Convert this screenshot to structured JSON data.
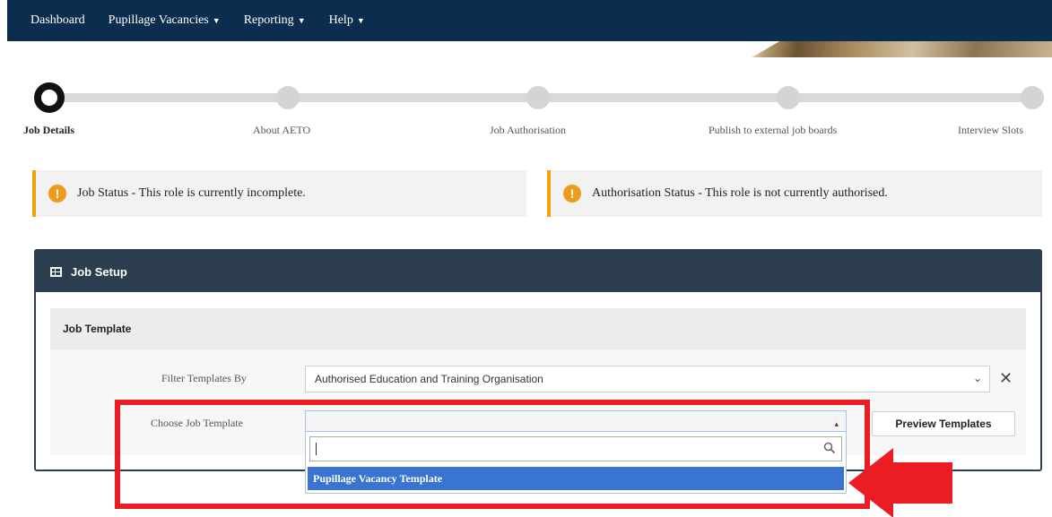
{
  "nav": {
    "items": [
      {
        "label": "Dashboard",
        "caret": false
      },
      {
        "label": "Pupillage Vacancies",
        "caret": true
      },
      {
        "label": "Reporting",
        "caret": true
      },
      {
        "label": "Help",
        "caret": true
      }
    ]
  },
  "stepper": {
    "steps": [
      {
        "label": "Job Details",
        "active": true
      },
      {
        "label": "About AETO",
        "active": false
      },
      {
        "label": "Job Authorisation",
        "active": false
      },
      {
        "label": "Publish to external job boards",
        "active": false
      },
      {
        "label": "Interview Slots",
        "active": false
      }
    ]
  },
  "alerts": {
    "job_status": "Job Status - This role is currently incomplete.",
    "authorisation_status": "Authorisation Status - This role is not currently authorised."
  },
  "panel": {
    "title": "Job Setup",
    "section_title": "Job Template",
    "filter_label": "Filter Templates By",
    "filter_value": "Authorised Education and Training Organisation",
    "choose_label": "Choose Job Template",
    "choose_value": "",
    "preview_button": "Preview Templates"
  },
  "dropdown": {
    "search_value": "",
    "options": [
      "Pupillage Vacancy Template"
    ]
  },
  "colors": {
    "navbar": "#0b2d4e",
    "panel_header": "#2c3e50",
    "warning": "#f0a30a",
    "highlight_option": "#3874d0",
    "annotation": "#ec1c24"
  }
}
